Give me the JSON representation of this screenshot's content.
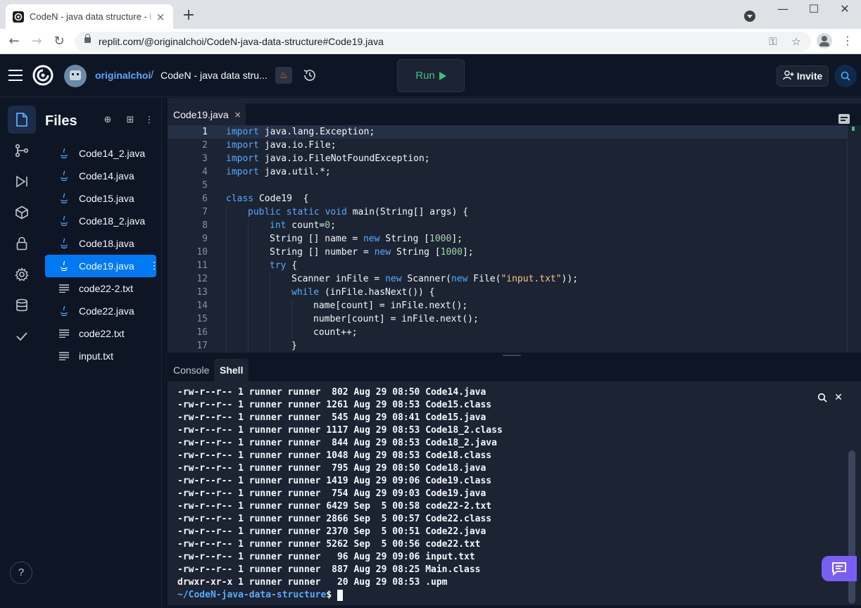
{
  "browser": {
    "tab_title": "CodeN - java data structure - R",
    "tab_close": "×",
    "new_tab": "+",
    "minimize": "—",
    "maximize": "☐",
    "close": "✕",
    "back": "←",
    "forward": "→",
    "reload": "↻",
    "url": "replit.com/@originalchoi/CodeN-java-data-structure#Code19.java",
    "key": "⚿",
    "star": "☆",
    "menu": "⋮"
  },
  "header": {
    "username": "originalchoi",
    "separator": "/",
    "repl_name": "CodeN - java data stru...",
    "lang_glyph": "♨",
    "run_label": "Run",
    "invite_label": "Invite",
    "invite_glyph": "+"
  },
  "rail": {
    "help_label": "?"
  },
  "files": {
    "title": "Files",
    "new_file_glyph": "⊕",
    "new_folder_glyph": "⊞",
    "menu_glyph": "⋮",
    "more_glyph": "⋮",
    "items": [
      {
        "name": "Code14_2.java",
        "type": "java",
        "selected": false
      },
      {
        "name": "Code14.java",
        "type": "java",
        "selected": false
      },
      {
        "name": "Code15.java",
        "type": "java",
        "selected": false
      },
      {
        "name": "Code18_2.java",
        "type": "java",
        "selected": false
      },
      {
        "name": "Code18.java",
        "type": "java",
        "selected": false
      },
      {
        "name": "Code19.java",
        "type": "java",
        "selected": true
      },
      {
        "name": "code22-2.txt",
        "type": "txt",
        "selected": false
      },
      {
        "name": "Code22.java",
        "type": "java",
        "selected": false
      },
      {
        "name": "code22.txt",
        "type": "txt",
        "selected": false
      },
      {
        "name": "input.txt",
        "type": "txt",
        "selected": false
      }
    ]
  },
  "editor": {
    "tab_name": "Code19.java",
    "tab_close": "×",
    "current_line": 1,
    "lines": [
      {
        "n": "1",
        "indent": 0,
        "tokens": [
          [
            "kw",
            "import"
          ],
          [
            "",
            "java.lang.Exception;"
          ]
        ]
      },
      {
        "n": "2",
        "indent": 0,
        "tokens": [
          [
            "kw",
            "import"
          ],
          [
            "",
            "java.io.File;"
          ]
        ]
      },
      {
        "n": "3",
        "indent": 0,
        "tokens": [
          [
            "kw",
            "import"
          ],
          [
            "",
            "java.io.FileNotFoundException;"
          ]
        ]
      },
      {
        "n": "4",
        "indent": 0,
        "tokens": [
          [
            "kw",
            "import"
          ],
          [
            "",
            "java.util.*;"
          ]
        ]
      },
      {
        "n": "5",
        "indent": 0,
        "tokens": []
      },
      {
        "n": "6",
        "indent": 0,
        "tokens": [
          [
            "kw",
            "class"
          ],
          [
            "",
            " Code19  {"
          ]
        ]
      },
      {
        "n": "7",
        "indent": 1,
        "tokens": [
          [
            "kw",
            "public static void"
          ],
          [
            "",
            " main(String[] args) {"
          ]
        ]
      },
      {
        "n": "8",
        "indent": 2,
        "tokens": [
          [
            "kw",
            "int"
          ],
          [
            "",
            " count="
          ],
          [
            "num",
            "0"
          ],
          [
            "",
            ";"
          ]
        ]
      },
      {
        "n": "9",
        "indent": 2,
        "tokens": [
          [
            "",
            "String [] name = "
          ],
          [
            "kw",
            "new"
          ],
          [
            "",
            " String ["
          ],
          [
            "num",
            "1000"
          ],
          [
            "",
            "];"
          ]
        ]
      },
      {
        "n": "10",
        "indent": 2,
        "tokens": [
          [
            "",
            "String [] number = "
          ],
          [
            "kw",
            "new"
          ],
          [
            "",
            " String ["
          ],
          [
            "num",
            "1000"
          ],
          [
            "",
            "];"
          ]
        ]
      },
      {
        "n": "11",
        "indent": 2,
        "tokens": [
          [
            "kw",
            "try"
          ],
          [
            "",
            " {"
          ]
        ]
      },
      {
        "n": "12",
        "indent": 3,
        "tokens": [
          [
            "",
            "Scanner inFile = "
          ],
          [
            "kw",
            "new"
          ],
          [
            "",
            " Scanner("
          ],
          [
            "kw",
            "new"
          ],
          [
            "",
            " File("
          ],
          [
            "str",
            "\"input.txt\""
          ],
          [
            "",
            "));"
          ]
        ]
      },
      {
        "n": "13",
        "indent": 3,
        "tokens": [
          [
            "kw",
            "while"
          ],
          [
            "",
            " (inFile.hasNext()) {"
          ]
        ]
      },
      {
        "n": "14",
        "indent": 4,
        "tokens": [
          [
            "",
            "name[count] = inFile.next();"
          ]
        ]
      },
      {
        "n": "15",
        "indent": 4,
        "tokens": [
          [
            "",
            "number[count] = inFile.next();"
          ]
        ]
      },
      {
        "n": "16",
        "indent": 4,
        "tokens": [
          [
            "",
            "count++;"
          ]
        ]
      },
      {
        "n": "17",
        "indent": 3,
        "tokens": [
          [
            "",
            "}"
          ]
        ]
      }
    ]
  },
  "terminal": {
    "tabs": [
      {
        "label": "Console",
        "active": false
      },
      {
        "label": "Shell",
        "active": true
      }
    ],
    "close_glyph": "✕",
    "lines": [
      "-rw-r--r-- 1 runner runner  802 Aug 29 08:50 Code14.java",
      "-rw-r--r-- 1 runner runner 1261 Aug 29 08:53 Code15.class",
      "-rw-r--r-- 1 runner runner  545 Aug 29 08:41 Code15.java",
      "-rw-r--r-- 1 runner runner 1117 Aug 29 08:53 Code18_2.class",
      "-rw-r--r-- 1 runner runner  844 Aug 29 08:53 Code18_2.java",
      "-rw-r--r-- 1 runner runner 1048 Aug 29 08:53 Code18.class",
      "-rw-r--r-- 1 runner runner  795 Aug 29 08:50 Code18.java",
      "-rw-r--r-- 1 runner runner 1419 Aug 29 09:06 Code19.class",
      "-rw-r--r-- 1 runner runner  754 Aug 29 09:03 Code19.java",
      "-rw-r--r-- 1 runner runner 6429 Sep  5 00:58 code22-2.txt",
      "-rw-r--r-- 1 runner runner 2866 Sep  5 00:57 Code22.class",
      "-rw-r--r-- 1 runner runner 2370 Sep  5 00:51 Code22.java",
      "-rw-r--r-- 1 runner runner 5262 Sep  5 00:56 code22.txt",
      "-rw-r--r-- 1 runner runner   96 Aug 29 09:06 input.txt",
      "-rw-r--r-- 1 runner runner  887 Aug 29 08:25 Main.class",
      "drwxr-xr-x 1 runner runner   20 Aug 29 08:53 .upm"
    ],
    "prompt_path": "~/CodeN-java-data-structure",
    "prompt_symbol": "$"
  },
  "colors": {
    "background": "#0e1525",
    "surface": "#1c2333",
    "accent_blue": "#0079f2",
    "link_blue": "#57abff",
    "run_green": "#3ac47d",
    "chat_purple": "#795ef2"
  }
}
